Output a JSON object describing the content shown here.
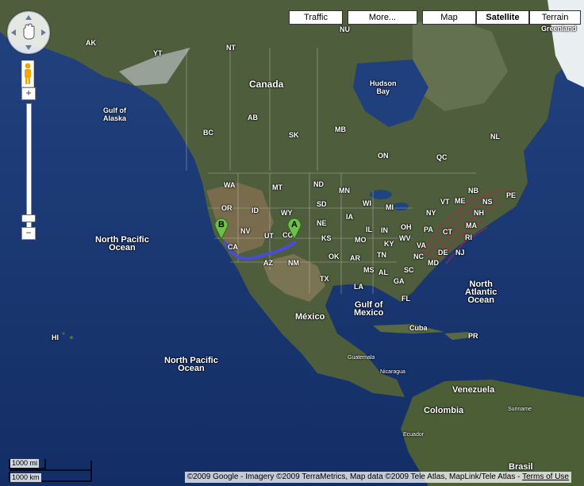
{
  "map_types": {
    "traffic": "Traffic",
    "more": "More...",
    "map": "Map",
    "satellite": "Satellite",
    "terrain": "Terrain",
    "selected": "satellite"
  },
  "controls": {
    "pan_icon": "hand-pan-icon",
    "pegman_icon": "pegman-icon",
    "zoom_in": "+",
    "zoom_out": "−",
    "zoom_level_fraction": 0.07
  },
  "scale": {
    "miles": "1000 mi",
    "km": "1000 km"
  },
  "copyright": {
    "text": "©2009 Google - Imagery ©2009 TerraMetrics, Map data ©2009 Tele Atlas, MapLink/Tele Atlas - ",
    "terms": "Terms of Use"
  },
  "markers": [
    {
      "letter": "A",
      "color": "#6fc04a"
    },
    {
      "letter": "B",
      "color": "#6fc04a"
    }
  ],
  "route_color": "#4a4ae8",
  "labels": {
    "greenland": "Greenland",
    "canada": "Canada",
    "hudson_bay": "Hudson\nBay",
    "ak": "AK",
    "yt": "YT",
    "nt": "NT",
    "nu": "NU",
    "gulf_of_alaska": "Gulf of\nAlaska",
    "bc": "BC",
    "ab": "AB",
    "sk": "SK",
    "mb": "MB",
    "on": "ON",
    "qc": "QC",
    "nl": "NL",
    "nb": "NB",
    "ns": "NS",
    "pe": "PE",
    "wa": "WA",
    "mt": "MT",
    "nd": "ND",
    "mn": "MN",
    "or": "OR",
    "id": "ID",
    "wy": "WY",
    "sd": "SD",
    "wi": "WI",
    "mi": "MI",
    "ny": "NY",
    "vt": "VT",
    "me": "ME",
    "nh": "NH",
    "ma": "MA",
    "ri": "RI",
    "ct": "CT",
    "pa": "PA",
    "nj": "NJ",
    "de": "DE",
    "md": "MD",
    "va": "VA",
    "wv": "WV",
    "oh": "OH",
    "in": "IN",
    "il": "IL",
    "ia": "IA",
    "ne": "NE",
    "nv": "NV",
    "ut": "UT",
    "co": "CO",
    "ks": "KS",
    "mo": "MO",
    "ky": "KY",
    "tn": "TN",
    "nc": "NC",
    "sc": "SC",
    "ca": "CA",
    "az": "AZ",
    "nm": "NM",
    "ok": "OK",
    "ar": "AR",
    "ms": "MS",
    "al": "AL",
    "ga": "GA",
    "la": "LA",
    "tx": "TX",
    "fl": "FL",
    "north_pacific_ocean_1": "North Pacific\nOcean",
    "north_pacific_ocean_2": "North Pacific\nOcean",
    "north_atlantic_ocean": "North\nAtlantic\nOcean",
    "gulf_of_mexico": "Gulf of\nMexico",
    "mexico": "México",
    "hi": "HI",
    "cuba": "Cuba",
    "pr": "PR",
    "guatemala": "Guatemala",
    "nicaragua": "Nicaragua",
    "venezuela": "Venezuela",
    "suriname": "Suriname",
    "colombia": "Colombia",
    "ecuador": "Ecuador",
    "brasil": "Brasil"
  }
}
